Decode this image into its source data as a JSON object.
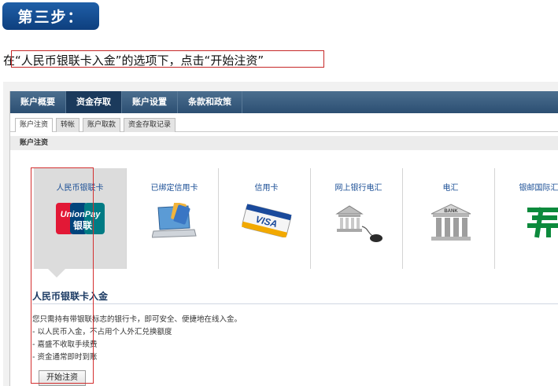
{
  "step": {
    "label": "第三步："
  },
  "instruction": {
    "text": "在“人民币银联卡入金”的选项下，点击“开始注资”"
  },
  "nav": {
    "tabs": [
      {
        "label": "账户概要"
      },
      {
        "label": "资金存取"
      },
      {
        "label": "账户设置"
      },
      {
        "label": "条款和政策"
      }
    ],
    "active_index": 1
  },
  "subtabs": [
    {
      "label": "账户注资"
    },
    {
      "label": "转帐"
    },
    {
      "label": "账户取款"
    },
    {
      "label": "资金存取记录"
    }
  ],
  "section": {
    "title": "账户注资"
  },
  "methods": [
    {
      "label": "人民币银联卡",
      "icon": "unionpay-icon"
    },
    {
      "label": "已绑定信用卡",
      "icon": "laptop-card-icon"
    },
    {
      "label": "信用卡",
      "icon": "visa-card-icon"
    },
    {
      "label": "网上银行电汇",
      "icon": "bank-mouse-icon"
    },
    {
      "label": "电汇",
      "icon": "bank-building-icon"
    },
    {
      "label": "银邮国际汇款",
      "icon": "china-post-icon"
    }
  ],
  "unionpay_logo": {
    "line1": "UnionPay",
    "line2": "银联"
  },
  "visa_logo": {
    "text": "VISA"
  },
  "bank_logo": {
    "text": "BANK"
  },
  "detail": {
    "title": "人民币银联卡入金",
    "lines": [
      "您只需持有带银联标志的银行卡，即可安全、便捷地在线入金。",
      "- 以人民币入金，不占用个人外汇兑换额度",
      "- 嘉盛不收取手续费",
      "- 资金通常即时到账"
    ],
    "button_label": "开始注资"
  },
  "colors": {
    "badge": "#1f5fa8",
    "nav": "#2c4f72",
    "highlight": "#d32f2f",
    "link": "#1b4f96"
  }
}
